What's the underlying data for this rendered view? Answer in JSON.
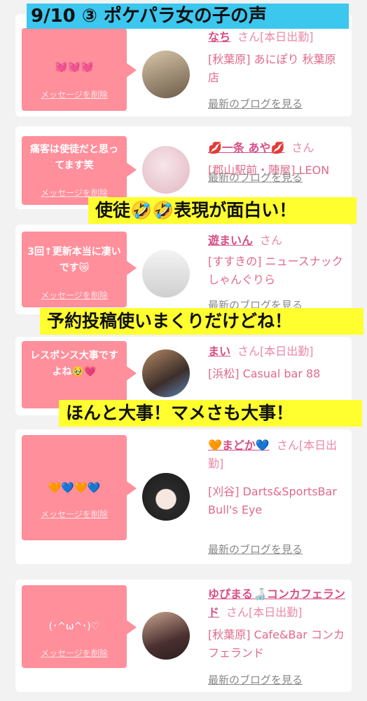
{
  "page_title": "9/10 ③ ポケパラ女の子の声",
  "delete_label": "メッセージを削除",
  "blog_label": "最新のブログを見る",
  "cards": [
    {
      "message": "💓💓💓",
      "name": "なち",
      "san": "さん[本日出勤]",
      "shop": "[秋葉原] あにぽり 秋葉原店"
    },
    {
      "message": "痛客は使徒だと思ってます笑",
      "name": "💋一条 あや💋",
      "san": "さん",
      "shop": "[郡山駅前・陣屋] LEON"
    },
    {
      "message": "3回↑更新本当に凄いです😿",
      "name": "遊まいん",
      "san": "さん",
      "shop": "[すすきの] ニュースナックしゃんぐりら"
    },
    {
      "message": "レスポンス大事ですよね🥹💗",
      "name": "まい",
      "san": "さん[本日出勤]",
      "shop": "[浜松] Casual bar 88"
    },
    {
      "message": "🧡💙🧡💙",
      "name": "🧡まどか💙",
      "san": "さん[本日出勤]",
      "shop": "[刈谷] Darts&SportsBar Bull's Eye"
    },
    {
      "message": "(･^ω^･)♡",
      "name": "ゆぴまる🍶コンカフェランド",
      "san": "さん[本日出勤]",
      "shop": "[秋葉原] Cafe&Bar コンカフェランド"
    }
  ],
  "captions": {
    "c1": "使徒🤣🤣表現が面白い！",
    "c2": "予約投稿使いまくりだけどね！",
    "c3": "ほんと大事！マメさも大事！"
  }
}
